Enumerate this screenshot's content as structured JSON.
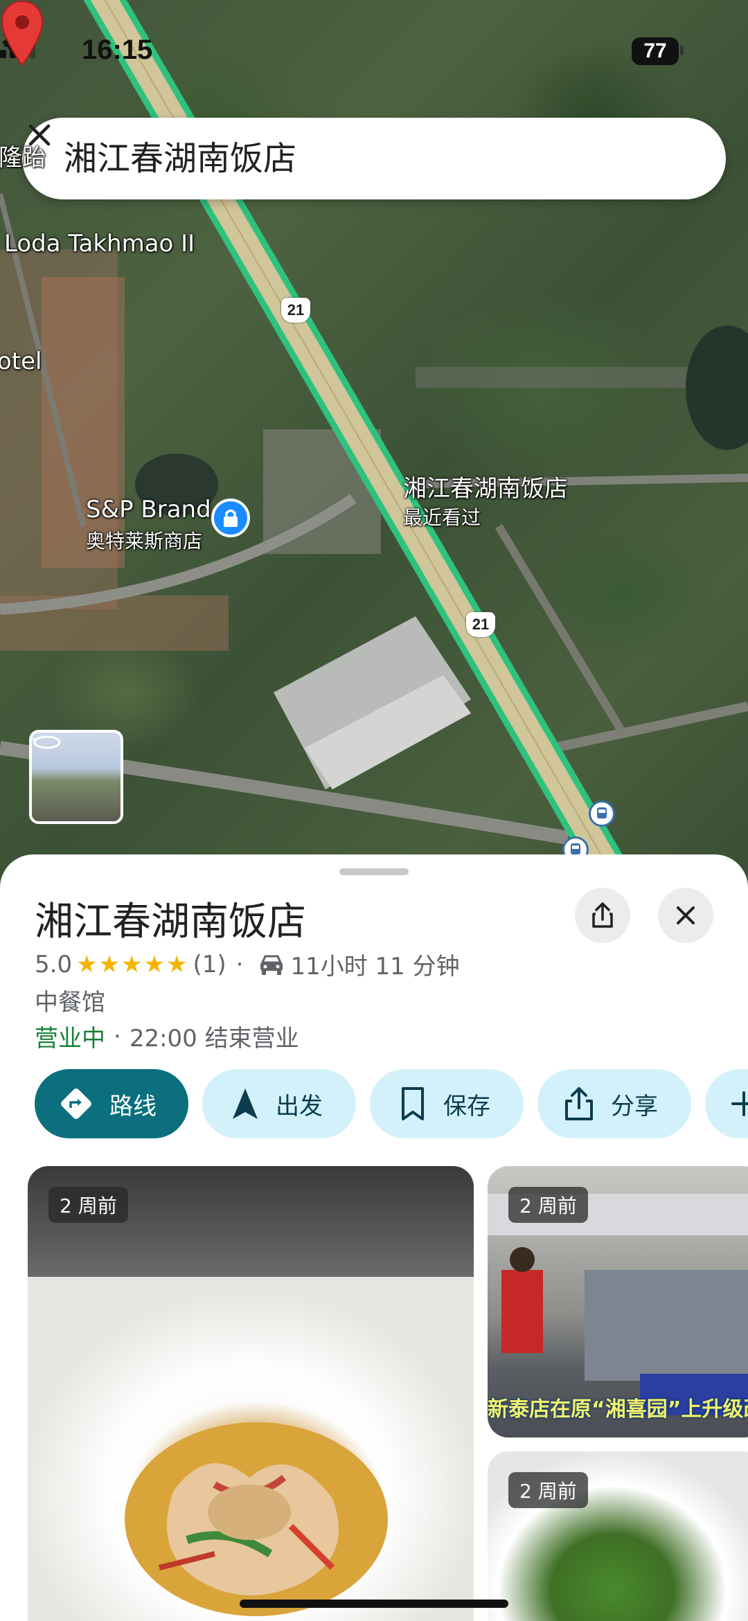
{
  "status_bar": {
    "time": "16:15",
    "battery": "77"
  },
  "search": {
    "query": "湘江春湖南饭店"
  },
  "map": {
    "labels": {
      "loda": "Loda Takhmao II",
      "otel": "otel",
      "edge": "隆跆",
      "sp_brand": "S&P Brand",
      "sp_brand_sub": "奥特莱斯商店",
      "place": "湘江春湖南饭店",
      "place_sub": "最近看过"
    },
    "road_shields": [
      "21",
      "21",
      "21"
    ]
  },
  "place": {
    "title": "湘江春湖南饭店",
    "rating": "5.0",
    "stars": "★★★★★",
    "review_count": "(1)",
    "separator": "·",
    "drive_time": "11小时 11 分钟",
    "category": "中餐馆",
    "open_status": "营业中",
    "hours": "22:00 结束营业"
  },
  "actions": {
    "directions": "路线",
    "start": "出发",
    "save": "保存",
    "share": "分享"
  },
  "photos": {
    "main_age": "2 周前",
    "side1_age": "2 周前",
    "side1_caption": "新泰店在原“湘喜园”上升级改",
    "side2_age": "2 周前"
  }
}
